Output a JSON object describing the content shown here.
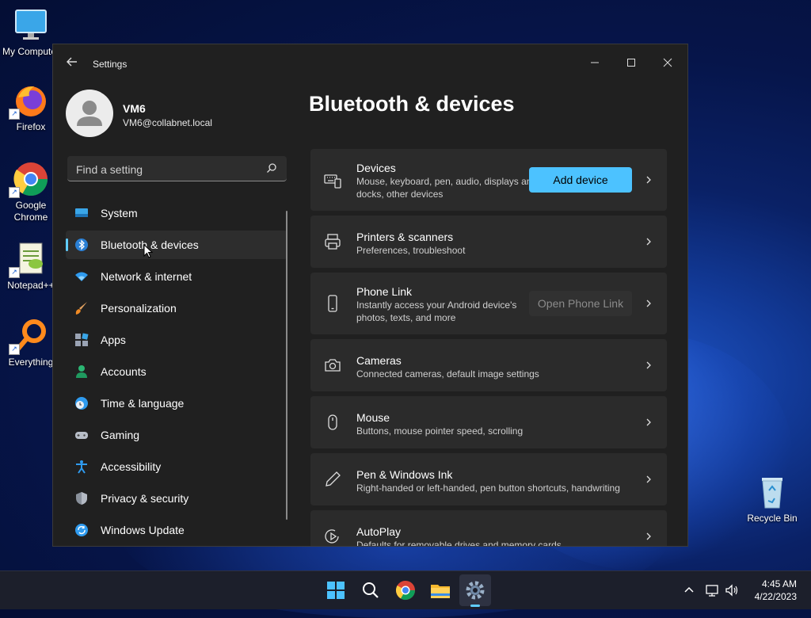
{
  "desktop": {
    "icons": [
      {
        "label": "My Computer"
      },
      {
        "label": "Firefox"
      },
      {
        "label": "Google Chrome"
      },
      {
        "label": "Notepad++"
      },
      {
        "label": "Everything"
      },
      {
        "label": "Recycle Bin"
      }
    ]
  },
  "window": {
    "title": "Settings",
    "user": {
      "name": "VM6",
      "email": "VM6@collabnet.local"
    },
    "search": {
      "placeholder": "Find a setting"
    },
    "nav": [
      {
        "label": "System",
        "icon": "system-icon"
      },
      {
        "label": "Bluetooth & devices",
        "icon": "bluetooth-icon",
        "selected": true
      },
      {
        "label": "Network & internet",
        "icon": "wifi-icon"
      },
      {
        "label": "Personalization",
        "icon": "brush-icon"
      },
      {
        "label": "Apps",
        "icon": "apps-icon"
      },
      {
        "label": "Accounts",
        "icon": "accounts-icon"
      },
      {
        "label": "Time & language",
        "icon": "globe-clock-icon"
      },
      {
        "label": "Gaming",
        "icon": "gamepad-icon"
      },
      {
        "label": "Accessibility",
        "icon": "accessibility-icon"
      },
      {
        "label": "Privacy & security",
        "icon": "shield-icon"
      },
      {
        "label": "Windows Update",
        "icon": "update-icon"
      }
    ],
    "page_title": "Bluetooth & devices",
    "cards": [
      {
        "title": "Devices",
        "subtitle": "Mouse, keyboard, pen, audio, displays and docks, other devices",
        "icon": "devices-icon",
        "button": "Add device"
      },
      {
        "title": "Printers & scanners",
        "subtitle": "Preferences, troubleshoot",
        "icon": "printer-icon"
      },
      {
        "title": "Phone Link",
        "subtitle": "Instantly access your Android device's photos, texts, and more",
        "icon": "phone-icon",
        "button": "Open Phone Link"
      },
      {
        "title": "Cameras",
        "subtitle": "Connected cameras, default image settings",
        "icon": "camera-icon"
      },
      {
        "title": "Mouse",
        "subtitle": "Buttons, mouse pointer speed, scrolling",
        "icon": "mouse-icon"
      },
      {
        "title": "Pen & Windows Ink",
        "subtitle": "Right-handed or left-handed, pen button shortcuts, handwriting",
        "icon": "pen-icon"
      },
      {
        "title": "AutoPlay",
        "subtitle": "Defaults for removable drives and memory cards",
        "icon": "autoplay-icon"
      }
    ]
  },
  "taskbar": {
    "apps": [
      "start-icon",
      "search-icon",
      "chrome-icon",
      "file-explorer-icon",
      "settings-icon"
    ],
    "clock": {
      "time": "4:45 AM",
      "date": "4/22/2023"
    }
  },
  "colors": {
    "accent": "#4cc2ff",
    "window_bg": "#202020",
    "card_bg": "#2b2b2b"
  }
}
